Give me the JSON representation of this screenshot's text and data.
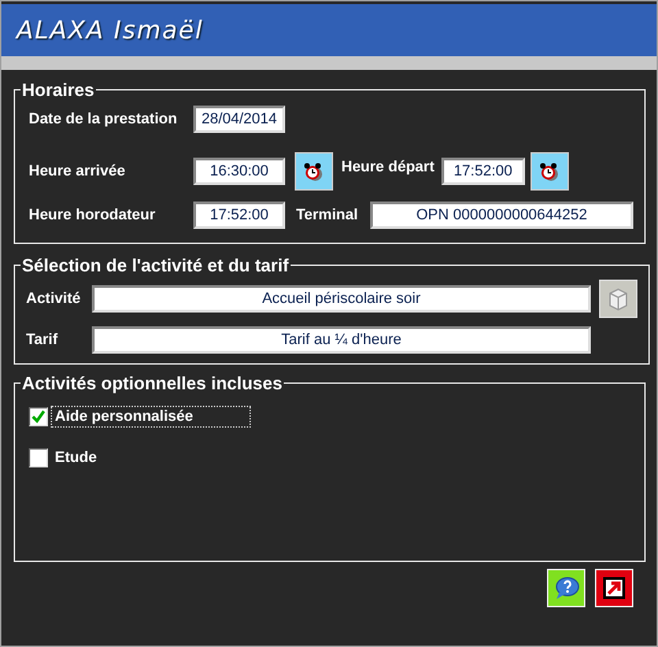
{
  "window": {
    "title": "ALAXA Ismaël"
  },
  "horaires": {
    "legend": "Horaires",
    "date": {
      "label": "Date de la prestation",
      "value": "28/04/2014"
    },
    "arrivee": {
      "label": "Heure arrivée",
      "value": "16:30:00"
    },
    "depart": {
      "label": "Heure départ",
      "value": "17:52:00"
    },
    "horodateur": {
      "label": "Heure horodateur",
      "value": "17:52:00"
    },
    "terminal": {
      "label": "Terminal",
      "value": "OPN 0000000000644252"
    }
  },
  "selection": {
    "legend": "Sélection de l'activité et du tarif",
    "activite": {
      "label": "Activité",
      "value": "Accueil périscolaire soir"
    },
    "tarif": {
      "label": "Tarif",
      "value": "Tarif au ¼ d'heure"
    }
  },
  "options": {
    "legend": "Activités optionnelles incluses",
    "items": [
      {
        "label": "Aide personnalisée",
        "checked": true,
        "focused": true
      },
      {
        "label": "Etude",
        "checked": false,
        "focused": false
      }
    ]
  }
}
